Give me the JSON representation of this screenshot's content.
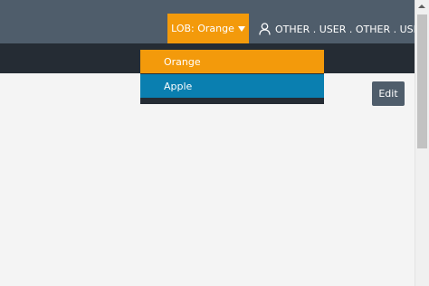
{
  "header": {
    "lob_label": "LOB: Orange",
    "user_label": "OTHER . USER . OTHER . USER"
  },
  "lob_menu": {
    "items": [
      {
        "label": "Orange",
        "color": "#f39a0b"
      },
      {
        "label": "Apple",
        "color": "#0a7fb0"
      }
    ]
  },
  "main": {
    "edit_label": "Edit"
  },
  "colors": {
    "topbar": "#4f5d6b",
    "subbar": "#252c34",
    "accent_orange": "#f39a0b",
    "accent_blue": "#0a7fb0"
  }
}
